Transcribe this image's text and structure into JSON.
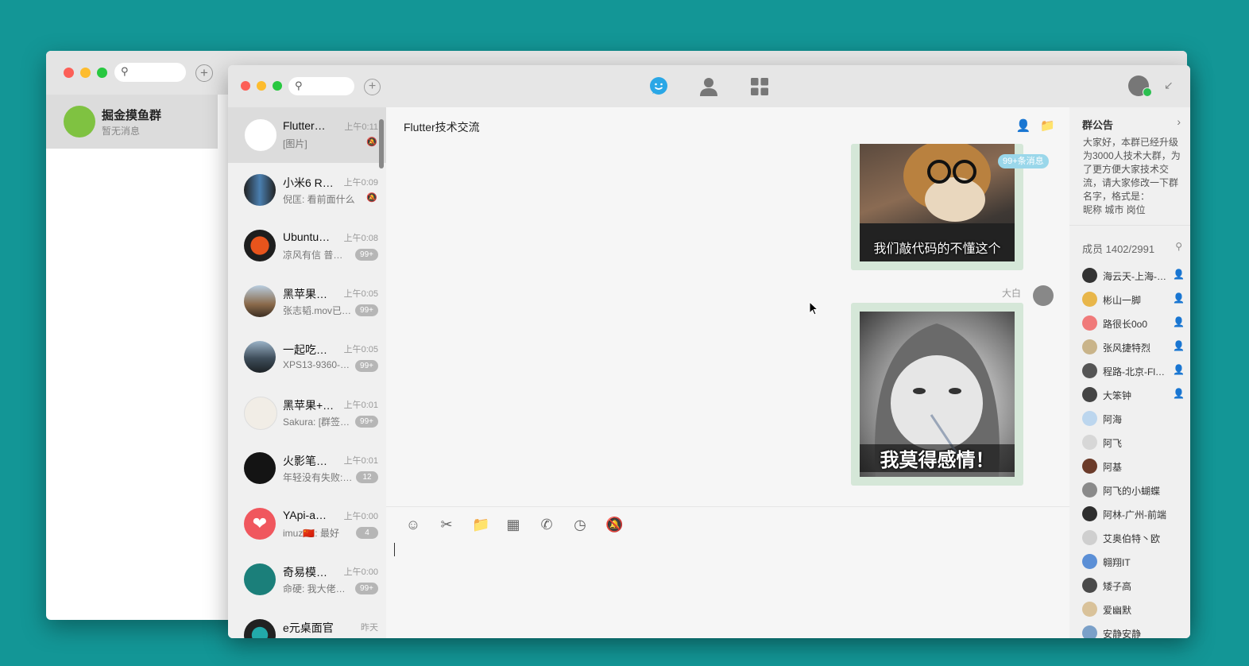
{
  "back_window": {
    "chat_name": "掘金摸鱼群",
    "chat_status": "暂无消息"
  },
  "colors": {
    "desktop": "#139696",
    "accent": "#2aa7e6",
    "bubble": "#d5e7d8",
    "badge": "#b6b6b6"
  },
  "icons": {
    "search": "search-icon",
    "add": "plus-icon",
    "chat": "chat-bubble-icon",
    "contacts": "contacts-icon",
    "apps": "apps-grid-icon"
  },
  "chat_list": [
    {
      "name": "Flutter…",
      "time": "上午0:11",
      "preview": "[图片]",
      "badge": "",
      "muted": true
    },
    {
      "name": "小米6 R…",
      "time": "上午0:09",
      "preview": "倪匡: 看前面什么…",
      "badge": "",
      "muted": true
    },
    {
      "name": "Ubuntu…",
      "time": "上午0:08",
      "preview": "凉风有信 普…",
      "badge": "99+",
      "muted": false
    },
    {
      "name": "黑苹果…",
      "time": "上午0:05",
      "preview": "张志韬.mov已…",
      "badge": "99+",
      "muted": false
    },
    {
      "name": "一起吃…",
      "time": "上午0:05",
      "preview": "XPS13-9360-…",
      "badge": "99+",
      "muted": false
    },
    {
      "name": "黑苹果+…",
      "time": "上午0:01",
      "preview": "Sakura: [群签…",
      "badge": "99+",
      "muted": false
    },
    {
      "name": "火影笔…",
      "time": "上午0:01",
      "preview": "年轻没有失败:…",
      "badge": "12",
      "muted": false
    },
    {
      "name": "YApi-a…",
      "time": "上午0:00",
      "preview": "imuz🇨🇳: 最好",
      "badge": "4",
      "muted": false
    },
    {
      "name": "奇易模…",
      "time": "上午0:00",
      "preview": "命硬: 我大佬…",
      "badge": "99+",
      "muted": false
    },
    {
      "name": "e元桌面官",
      "time": "昨天",
      "preview": "",
      "badge": "",
      "muted": false
    }
  ],
  "conversation": {
    "title": "Flutter技术交流",
    "new_messages_badge": "99+条消息",
    "caption_1": "我们敲代码的不懂这个",
    "sender": "大白",
    "caption_2": "我莫得感情！"
  },
  "group_panel": {
    "notice_title": "群公告",
    "notice_text": "大家好，本群已经升级为3000人技术大群，为了更方便大家技术交流，请大家修改一下群名字，格式是：",
    "notice_format": "昵称 城市 岗位",
    "members_label": "成员 1402/2991",
    "members": [
      {
        "name": "海云天-上海-…",
        "admin": true
      },
      {
        "name": "彬山一脚",
        "admin": true
      },
      {
        "name": "路很长0o0",
        "admin": true
      },
      {
        "name": "张风捷特烈",
        "admin": true
      },
      {
        "name": "程路-北京-Fl…",
        "admin": true
      },
      {
        "name": "大笨钟",
        "admin": true
      },
      {
        "name": "阿海",
        "admin": false
      },
      {
        "name": "阿飞",
        "admin": false
      },
      {
        "name": "阿基",
        "admin": false
      },
      {
        "name": "阿飞的小蝴蝶",
        "admin": false
      },
      {
        "name": "阿林-广州-前端",
        "admin": false
      },
      {
        "name": "艾奥伯特丶欧",
        "admin": false
      },
      {
        "name": "翱翔IT",
        "admin": false
      },
      {
        "name": "矮子高",
        "admin": false
      },
      {
        "name": "爱幽默",
        "admin": false
      },
      {
        "name": "安静安静",
        "admin": false
      }
    ]
  }
}
